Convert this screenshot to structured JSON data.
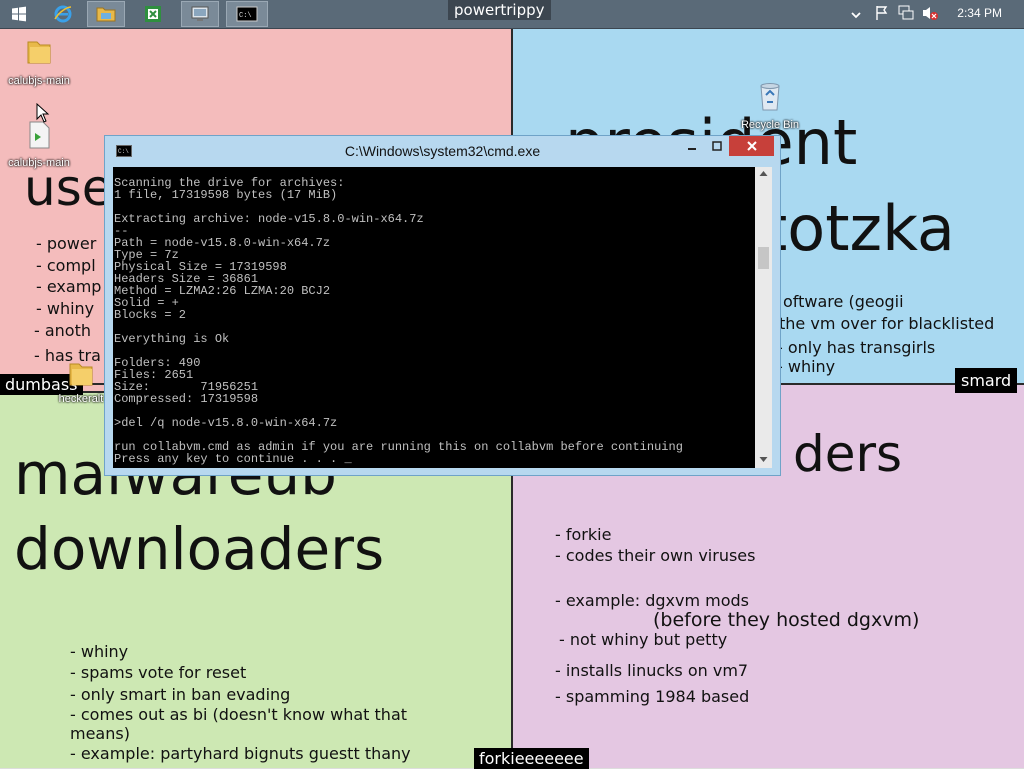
{
  "taskbar": {
    "clock": "2:34 PM",
    "overlay_tag": "powertrippy"
  },
  "desktop": {
    "icons": [
      {
        "label": "calubjs-main",
        "icon": "folder-icon"
      },
      {
        "label": "calubjs-main",
        "icon": "file-icon"
      },
      {
        "label": "Recycle Bin",
        "icon": "recycle-bin-icon"
      },
      {
        "label": "heckeralt",
        "icon": "folder-icon"
      }
    ]
  },
  "quadrants": {
    "top_left": {
      "title": "use",
      "bullets": [
        "- power",
        "- compl",
        "- examp",
        "- whiny",
        "- anoth",
        "- has tra"
      ],
      "tag": "dumbass"
    },
    "top_right": {
      "title_line1": "president",
      "title_line2": "totzka",
      "bullets": [
        "oftware (geogii",
        "the vm over for blacklisted",
        "- only has transgirls",
        "- whiny"
      ],
      "tag": "smard"
    },
    "bottom_left": {
      "title_line1": "malwareub",
      "title_line2": "downloaders",
      "bullets": [
        "- whiny",
        "- spams vote for reset",
        "- only smart in ban evading",
        "- comes out as bi (doesn't know what that",
        "means)",
        "- example: partyhard bignuts guestt thany"
      ],
      "tag": "forkieeeeeee"
    },
    "bottom_right": {
      "title": "ders",
      "bullets": [
        "- forkie",
        "- codes their own viruses",
        "- example: dgxvm mods",
        "(before they hosted dgxvm)",
        "- not whiny but petty",
        "- installs linucks on vm7",
        "- spamming 1984 based"
      ]
    }
  },
  "cmd_window": {
    "title": "C:\\Windows\\system32\\cmd.exe",
    "lines": [
      "Scanning the drive for archives:",
      "1 file, 17319598 bytes (17 MiB)",
      "",
      "Extracting archive: node-v15.8.0-win-x64.7z",
      "--",
      "Path = node-v15.8.0-win-x64.7z",
      "Type = 7z",
      "Physical Size = 17319598",
      "Headers Size = 36861",
      "Method = LZMA2:26 LZMA:20 BCJ2",
      "Solid = +",
      "Blocks = 2",
      "",
      "Everything is Ok",
      "",
      "Folders: 490",
      "Files: 2651",
      "Size:       71956251",
      "Compressed: 17319598",
      "",
      ">del /q node-v15.8.0-win-x64.7z",
      "",
      "run collabvm.cmd as admin if you are running this on collabvm before continuing",
      "Press any key to continue . . . _"
    ]
  }
}
